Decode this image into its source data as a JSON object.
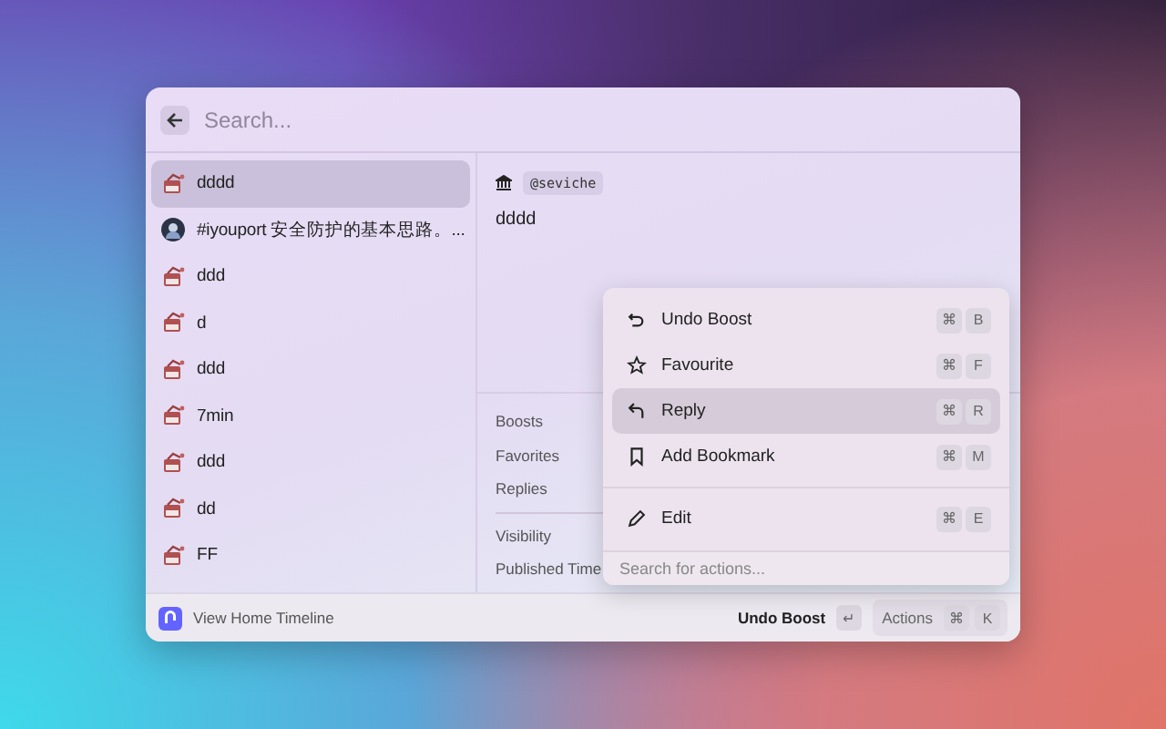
{
  "search": {
    "placeholder": "Search..."
  },
  "list": [
    {
      "kind": "app",
      "title": "dddd",
      "selected": true
    },
    {
      "kind": "round",
      "title": "#iyouport 安全防护的基本思路。...",
      "selected": false
    },
    {
      "kind": "app",
      "title": "ddd",
      "selected": false
    },
    {
      "kind": "app",
      "title": "d",
      "selected": false
    },
    {
      "kind": "app",
      "title": "ddd",
      "selected": false
    },
    {
      "kind": "app",
      "title": "7min",
      "selected": false
    },
    {
      "kind": "app",
      "title": "ddd",
      "selected": false
    },
    {
      "kind": "app",
      "title": "dd",
      "selected": false
    },
    {
      "kind": "app",
      "title": "FF",
      "selected": false
    }
  ],
  "detail": {
    "handle": "@seviche",
    "text": "dddd",
    "stats": [
      "Boosts",
      "Favorites",
      "Replies"
    ],
    "meta": [
      "Visibility",
      "Published Time"
    ]
  },
  "menu": {
    "items": [
      {
        "label": "Undo Boost",
        "keys": [
          "⌘",
          "B"
        ],
        "selected": false
      },
      {
        "label": "Favourite",
        "keys": [
          "⌘",
          "F"
        ],
        "selected": false
      },
      {
        "label": "Reply",
        "keys": [
          "⌘",
          "R"
        ],
        "selected": true
      },
      {
        "label": "Add Bookmark",
        "keys": [
          "⌘",
          "M"
        ],
        "selected": false
      },
      {
        "label": "Edit",
        "keys": [
          "⌘",
          "E"
        ],
        "selected": false
      }
    ],
    "search_placeholder": "Search for actions..."
  },
  "footer": {
    "title": "View Home Timeline",
    "primary_action": "Undo Boost",
    "enter_key": "↵",
    "actions_label": "Actions",
    "actions_keys": [
      "⌘",
      "K"
    ]
  }
}
